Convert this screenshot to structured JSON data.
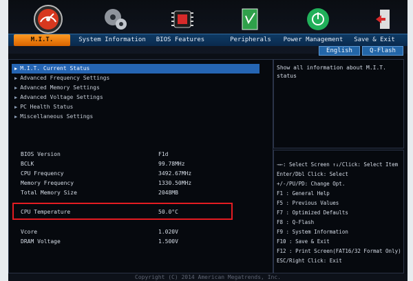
{
  "window": {
    "top_caption": "",
    "footer": "Copyright (C) 2014 American Megatrends, Inc."
  },
  "tabs": [
    {
      "label": "M.I.T.",
      "active": true,
      "icon": "speedometer-icon"
    },
    {
      "label": "System Information",
      "active": false,
      "icon": "gear-icon"
    },
    {
      "label": "BIOS Features",
      "active": false,
      "icon": "chip-icon"
    },
    {
      "label": "Peripherals",
      "active": false,
      "icon": "document-icon"
    },
    {
      "label": "Power Management",
      "active": false,
      "icon": "power-icon"
    },
    {
      "label": "Save & Exit",
      "active": false,
      "icon": "exit-icon"
    }
  ],
  "lang_buttons": [
    "English",
    "Q-Flash"
  ],
  "menu": [
    {
      "label": "M.I.T. Current Status",
      "selected": true
    },
    {
      "label": "Advanced Frequency Settings",
      "selected": false
    },
    {
      "label": "Advanced Memory Settings",
      "selected": false
    },
    {
      "label": "Advanced Voltage Settings",
      "selected": false
    },
    {
      "label": "PC Health Status",
      "selected": false
    },
    {
      "label": "Miscellaneous Settings",
      "selected": false
    }
  ],
  "info_top": [
    {
      "label": "BIOS Version",
      "value": "F1d"
    },
    {
      "label": "BCLK",
      "value": "99.78MHz"
    },
    {
      "label": "CPU Frequency",
      "value": "3492.67MHz"
    },
    {
      "label": "Memory Frequency",
      "value": "1330.50MHz"
    },
    {
      "label": "Total Memory Size",
      "value": "2048MB"
    }
  ],
  "info_cpu": [
    {
      "label": "CPU Temperature",
      "value": "50.0°C"
    }
  ],
  "info_bottom": [
    {
      "label": "Vcore",
      "value": "1.020V"
    },
    {
      "label": "DRAM Voltage",
      "value": "1.500V"
    }
  ],
  "help": "Show all information about M.I.T. status",
  "keys": [
    "→←: Select Screen  ↑↓/Click: Select Item",
    "Enter/Dbl Click: Select",
    "+/-/PU/PD: Change Opt.",
    "F1  : General Help",
    "F5  : Previous Values",
    "F7  : Optimized Defaults",
    "F8  : Q-Flash",
    "F9  : System Information",
    "F10 : Save & Exit",
    "F12 : Print Screen(FAT16/32 Format Only)",
    "ESC/Right Click: Exit"
  ],
  "colors": {
    "active_tab": "#ff9a22",
    "selection": "#2565b3",
    "highlight_box": "#e51c22"
  }
}
